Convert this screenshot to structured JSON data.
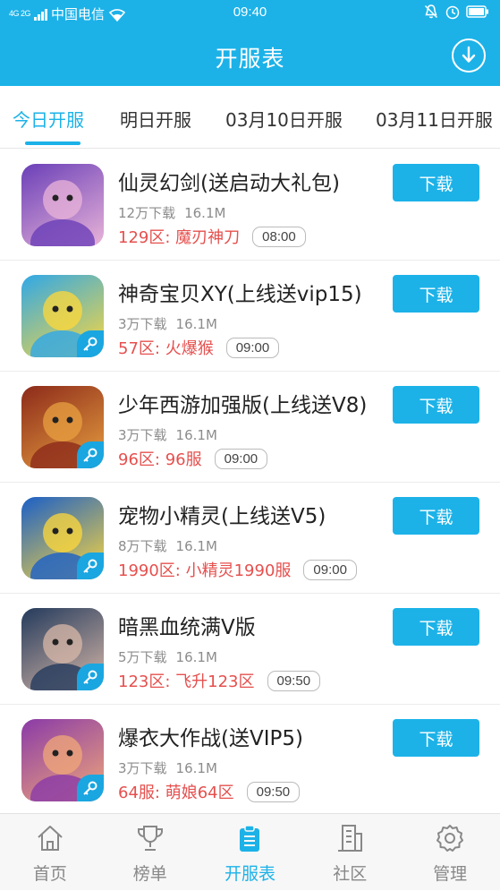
{
  "status_bar": {
    "network": "4G 2G",
    "carrier": "中国电信",
    "time": "09:40"
  },
  "header": {
    "title": "开服表",
    "download_icon": "download-circle-icon"
  },
  "tabs": [
    {
      "label": "今日开服",
      "active": true
    },
    {
      "label": "明日开服",
      "active": false
    },
    {
      "label": "03月10日开服",
      "active": false
    },
    {
      "label": "03月11日开服",
      "active": false
    }
  ],
  "games": [
    {
      "title": "仙灵幻剑(送启动大礼包)",
      "downloads": "12万下载",
      "size": "16.1M",
      "server": "129区: 魔刃神刀",
      "time": "08:00",
      "button": "下载",
      "has_key_badge": false,
      "icon_colors": [
        "#6a3fb8",
        "#e9b4d8"
      ]
    },
    {
      "title": "神奇宝贝XY(上线送vip15)",
      "downloads": "3万下载",
      "size": "16.1M",
      "server": "57区: 火爆猴",
      "time": "09:00",
      "button": "下载",
      "has_key_badge": true,
      "icon_colors": [
        "#2fa8e8",
        "#ffd83a"
      ]
    },
    {
      "title": "少年西游加强版(上线送V8)",
      "downloads": "3万下载",
      "size": "16.1M",
      "server": "96区: 96服",
      "time": "09:00",
      "button": "下载",
      "has_key_badge": true,
      "icon_colors": [
        "#8c2a1a",
        "#e8a040"
      ]
    },
    {
      "title": "宠物小精灵(上线送V5)",
      "downloads": "8万下载",
      "size": "16.1M",
      "server": "1990区: 小精灵1990服",
      "time": "09:00",
      "button": "下载",
      "has_key_badge": true,
      "icon_colors": [
        "#1a5fc8",
        "#ffd83a"
      ]
    },
    {
      "title": "暗黑血统满V版",
      "downloads": "5万下载",
      "size": "16.1M",
      "server": "123区: 飞升123区",
      "time": "09:50",
      "button": "下载",
      "has_key_badge": true,
      "icon_colors": [
        "#233a5c",
        "#d8b8a8"
      ]
    },
    {
      "title": "爆衣大作战(送VIP5)",
      "downloads": "3万下载",
      "size": "16.1M",
      "server": "64服: 萌娘64区",
      "time": "09:50",
      "button": "下载",
      "has_key_badge": true,
      "icon_colors": [
        "#8a3aa8",
        "#f0a878"
      ]
    }
  ],
  "bottom_nav": [
    {
      "label": "首页",
      "icon": "home-icon",
      "active": false
    },
    {
      "label": "榜单",
      "icon": "trophy-icon",
      "active": false
    },
    {
      "label": "开服表",
      "icon": "clipboard-icon",
      "active": true
    },
    {
      "label": "社区",
      "icon": "building-icon",
      "active": false
    },
    {
      "label": "管理",
      "icon": "gear-icon",
      "active": false
    }
  ],
  "colors": {
    "primary": "#1cb2e8",
    "server_text": "#e5504e"
  }
}
